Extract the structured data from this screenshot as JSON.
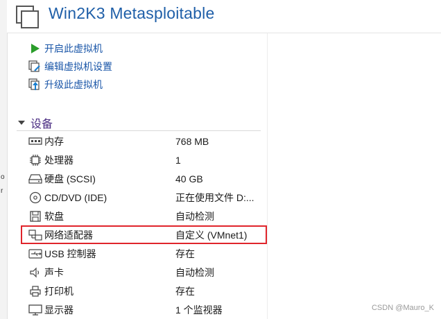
{
  "window": {
    "title": "Win2K3 Metasploitable"
  },
  "left_strip": {
    "glyphs": [
      "o",
      "r"
    ]
  },
  "actions": [
    {
      "label": "开启此虚拟机",
      "icon": "play-icon"
    },
    {
      "label": "编辑虚拟机设置",
      "icon": "edit-settings-icon"
    },
    {
      "label": "升级此虚拟机",
      "icon": "upgrade-icon"
    }
  ],
  "devices_section": {
    "title": "设备",
    "devices": [
      {
        "name": "内存",
        "value": "768 MB",
        "icon": "memory-icon"
      },
      {
        "name": "处理器",
        "value": "1",
        "icon": "processor-icon"
      },
      {
        "name": "硬盘 (SCSI)",
        "value": "40 GB",
        "icon": "hard-disk-icon"
      },
      {
        "name": "CD/DVD (IDE)",
        "value": "正在使用文件 D:...",
        "icon": "cd-dvd-icon"
      },
      {
        "name": "软盘",
        "value": "自动检测",
        "icon": "floppy-icon"
      },
      {
        "name": "网络适配器",
        "value": "自定义 (VMnet1)",
        "icon": "network-adapter-icon",
        "highlighted": true
      },
      {
        "name": "USB 控制器",
        "value": "存在",
        "icon": "usb-icon"
      },
      {
        "name": "声卡",
        "value": "自动检测",
        "icon": "sound-card-icon"
      },
      {
        "name": "打印机",
        "value": "存在",
        "icon": "printer-icon"
      },
      {
        "name": "显示器",
        "value": "1 个监视器",
        "icon": "display-icon"
      }
    ]
  },
  "watermark": "CSDN @Mauro_K",
  "colors": {
    "title": "#1f5fa8",
    "action_link": "#1a56a8",
    "section_title": "#4a2c82",
    "highlight_border": "#e0242b",
    "play_green": "#2a9d2a"
  }
}
